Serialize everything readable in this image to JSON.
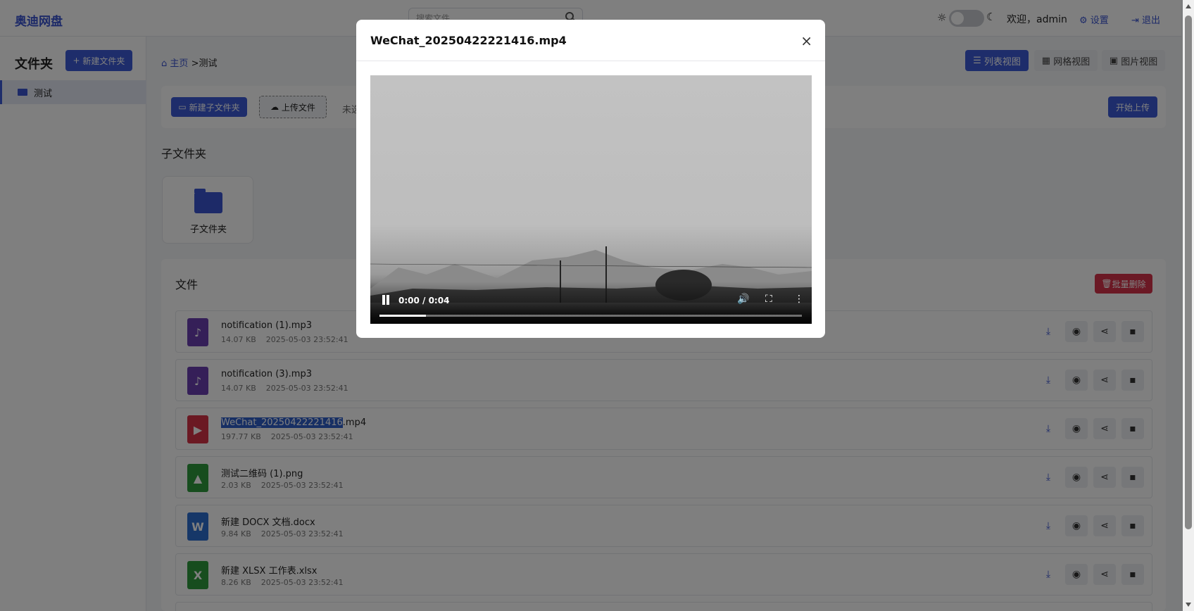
{
  "app": {
    "title": "奥迪网盘"
  },
  "header": {
    "search_placeholder": "搜索文件",
    "welcome": "欢迎，admin",
    "settings_label": "设置",
    "logout_label": "退出"
  },
  "sidebar": {
    "title": "文件夹",
    "new_folder_label": "新建文件夹",
    "items": [
      {
        "label": "测试"
      }
    ]
  },
  "breadcrumb": {
    "home": "主页",
    "separator": ">",
    "current": "测试"
  },
  "views": {
    "list": "列表视图",
    "grid": "网格视图",
    "image": "图片视图"
  },
  "toolbar": {
    "new_subfolder": "新建子文件夹",
    "upload": "上传文件",
    "no_file": "未选",
    "start_upload": "开始上传"
  },
  "subfolders": {
    "title": "子文件夹",
    "items": [
      {
        "label": "子文件夹"
      }
    ]
  },
  "files": {
    "title": "文件",
    "bulk_delete": "批量删除",
    "items": [
      {
        "name": "notification (1).mp3",
        "size": "14.07 KB",
        "date": "2025-05-03 23:52:41",
        "type": "audio"
      },
      {
        "name": "notification (3).mp3",
        "size": "14.07 KB",
        "date": "2025-05-03 23:52:41",
        "type": "audio"
      },
      {
        "name_highlight": "WeChat_20250422221416",
        "name_rest": ".mp4",
        "size": "197.77 KB",
        "date": "2025-05-03 23:52:41",
        "type": "video"
      },
      {
        "name": "测试二维码 (1).png",
        "size": "2.03 KB",
        "date": "2025-05-03 23:52:41",
        "type": "image"
      },
      {
        "name": "新建 DOCX 文档.docx",
        "size": "9.84 KB",
        "date": "2025-05-03 23:52:41",
        "type": "word"
      },
      {
        "name": "新建 XLSX 工作表.xlsx",
        "size": "8.26 KB",
        "date": "2025-05-03 23:52:41",
        "type": "excel"
      }
    ]
  },
  "modal": {
    "title": "WeChat_20250422221416.mp4",
    "video_time": "0:00 / 0:04",
    "progress": 0.11
  },
  "colors": {
    "accent": "#3c5ad6",
    "danger": "#d6334b",
    "audio": "#6b3fb0",
    "video": "#d63346",
    "image": "#2e9a3d",
    "word": "#2c6fd1",
    "excel": "#2e9a3d"
  }
}
